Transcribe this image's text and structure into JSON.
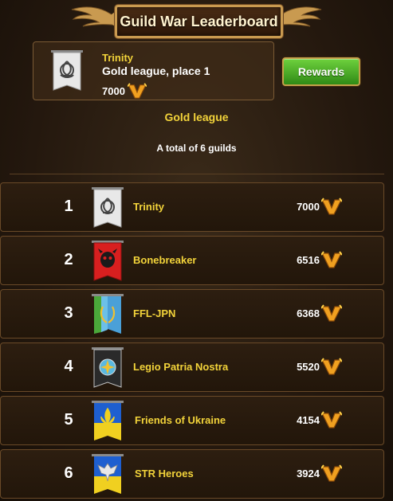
{
  "header": {
    "title": "Guild War Leaderboard"
  },
  "my_guild": {
    "name": "Trinity",
    "place_text": "Gold league, place 1",
    "score": "7000",
    "banner_icon": "triquetra-icon"
  },
  "rewards_button": {
    "label": "Rewards"
  },
  "league": {
    "name": "Gold league",
    "total_text": "A total of 6 guilds"
  },
  "guilds": [
    {
      "rank": "1",
      "name": "Trinity",
      "score": "7000",
      "banner_icon": "triquetra-icon",
      "banner_color": "#e8e8e8"
    },
    {
      "rank": "2",
      "name": "Bonebreaker",
      "score": "6516",
      "banner_icon": "demon-skull-icon",
      "banner_color": "#d81f1f"
    },
    {
      "rank": "3",
      "name": "FFL-JPN",
      "score": "6368",
      "banner_icon": "laurel-wreath-icon",
      "banner_color": "#4aa0d8"
    },
    {
      "rank": "4",
      "name": "Legio Patria Nostra",
      "score": "5520",
      "banner_icon": "star-emblem-icon",
      "banner_color": "#2a2a2a"
    },
    {
      "rank": "5",
      "name": "Friends of Ukraine",
      "score": "4154",
      "banner_icon": "fleur-de-lis-icon",
      "banner_color": "#1e5fd0"
    },
    {
      "rank": "6",
      "name": "STR Heroes",
      "score": "3924",
      "banner_icon": "eagle-icon",
      "banner_color": "#1e5fd0"
    }
  ]
}
